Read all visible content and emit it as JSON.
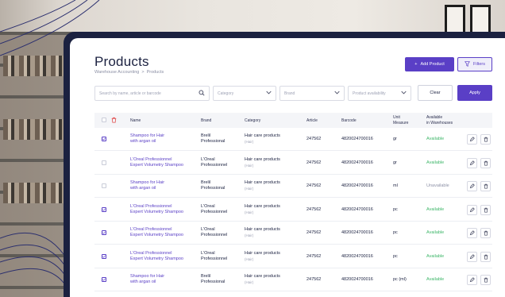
{
  "page": {
    "title": "Products",
    "breadcrumb": [
      "Warehouse Accounting",
      "Products"
    ],
    "breadcrumb_sep": ">"
  },
  "toolbar": {
    "add_label": "Add Product",
    "add_icon": "+",
    "filters_label": "Filters"
  },
  "filters": {
    "search_placeholder": "Search by name, article or barcode",
    "category_placeholder": "Category",
    "brand_placeholder": "Brand",
    "availability_placeholder": "Product availability",
    "clear_label": "Clear",
    "apply_label": "Apply"
  },
  "table": {
    "headers": {
      "name": "Name",
      "brand": "Brand",
      "category": "Category",
      "article": "Article",
      "barcode": "Barcode",
      "unit_line1": "Unit",
      "unit_line2": "Measure",
      "avail_line1": "Available",
      "avail_line2": "in Warehouses"
    },
    "rows": [
      {
        "checked": true,
        "name1": "Shampoo for Hair",
        "name2": "with argan oil",
        "brand1": "Brelil",
        "brand2": "Professional",
        "cat": "Hair care products",
        "cat_sub": "(Hair)",
        "article": "247562",
        "barcode": "4820024700016",
        "unit": "gr",
        "status": "Available"
      },
      {
        "checked": false,
        "name1": "L'Oreal Professionnel",
        "name2": "Expert Volumetry Shampoo",
        "brand1": "L'Oreal",
        "brand2": "Professionnel",
        "cat": "Hair care products",
        "cat_sub": "(Hair)",
        "article": "247562",
        "barcode": "4820024700016",
        "unit": "gr",
        "status": "Available"
      },
      {
        "checked": false,
        "name1": "Shampoo for Hair",
        "name2": "with argan oil",
        "brand1": "Brelil",
        "brand2": "Professional",
        "cat": "Hair care products",
        "cat_sub": "(Hair)",
        "article": "247562",
        "barcode": "4820024700016",
        "unit": "ml",
        "status": "Unavailable"
      },
      {
        "checked": true,
        "name1": "L'Oreal Professionnel",
        "name2": "Expert Volumetry Shampoo",
        "brand1": "L'Oreal",
        "brand2": "Professionnel",
        "cat": "Hair care products",
        "cat_sub": "(Hair)",
        "article": "247562",
        "barcode": "4820024700016",
        "unit": "pc",
        "status": "Available"
      },
      {
        "checked": true,
        "name1": "L'Oreal Professionnel",
        "name2": "Expert Volumetry Shampoo",
        "brand1": "L'Oreal",
        "brand2": "Professionnel",
        "cat": "Hair care products",
        "cat_sub": "(Hair)",
        "article": "247562",
        "barcode": "4820024700016",
        "unit": "pc",
        "status": "Available"
      },
      {
        "checked": true,
        "name1": "L'Oreal Professionnel",
        "name2": "Expert Volumetry Shampoo",
        "brand1": "L'Oreal",
        "brand2": "Professionnel",
        "cat": "Hair care products",
        "cat_sub": "(Hair)",
        "article": "247562",
        "barcode": "4820024700016",
        "unit": "pc",
        "status": "Available"
      },
      {
        "checked": true,
        "name1": "Shampoo for Hair",
        "name2": "with argan oil",
        "brand1": "Brelil",
        "brand2": "Professional",
        "cat": "Hair care products",
        "cat_sub": "(Hair)",
        "article": "247562",
        "barcode": "4820024700016",
        "unit": "pc (ml)",
        "status": "Available"
      }
    ]
  },
  "icons": {
    "search": "search-icon",
    "chevron": "chevron-down-icon",
    "filter": "filter-icon",
    "edit": "pencil-icon",
    "delete": "trash-icon",
    "check": "checkmark-icon"
  },
  "colors": {
    "accent": "#5a3fc6",
    "available": "#3fb76a",
    "unavailable": "#8f93a8",
    "frame": "#1b2140",
    "delete": "#e04646"
  }
}
